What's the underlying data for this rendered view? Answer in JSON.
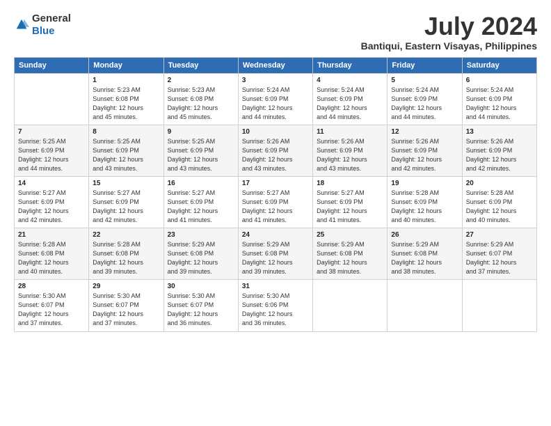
{
  "logo": {
    "general": "General",
    "blue": "Blue"
  },
  "header": {
    "title": "July 2024",
    "subtitle": "Bantiqui, Eastern Visayas, Philippines"
  },
  "weekdays": [
    "Sunday",
    "Monday",
    "Tuesday",
    "Wednesday",
    "Thursday",
    "Friday",
    "Saturday"
  ],
  "weeks": [
    [
      {
        "day": "",
        "info": ""
      },
      {
        "day": "1",
        "info": "Sunrise: 5:23 AM\nSunset: 6:08 PM\nDaylight: 12 hours\nand 45 minutes."
      },
      {
        "day": "2",
        "info": "Sunrise: 5:23 AM\nSunset: 6:08 PM\nDaylight: 12 hours\nand 45 minutes."
      },
      {
        "day": "3",
        "info": "Sunrise: 5:24 AM\nSunset: 6:09 PM\nDaylight: 12 hours\nand 44 minutes."
      },
      {
        "day": "4",
        "info": "Sunrise: 5:24 AM\nSunset: 6:09 PM\nDaylight: 12 hours\nand 44 minutes."
      },
      {
        "day": "5",
        "info": "Sunrise: 5:24 AM\nSunset: 6:09 PM\nDaylight: 12 hours\nand 44 minutes."
      },
      {
        "day": "6",
        "info": "Sunrise: 5:24 AM\nSunset: 6:09 PM\nDaylight: 12 hours\nand 44 minutes."
      }
    ],
    [
      {
        "day": "7",
        "info": "Sunrise: 5:25 AM\nSunset: 6:09 PM\nDaylight: 12 hours\nand 44 minutes."
      },
      {
        "day": "8",
        "info": "Sunrise: 5:25 AM\nSunset: 6:09 PM\nDaylight: 12 hours\nand 43 minutes."
      },
      {
        "day": "9",
        "info": "Sunrise: 5:25 AM\nSunset: 6:09 PM\nDaylight: 12 hours\nand 43 minutes."
      },
      {
        "day": "10",
        "info": "Sunrise: 5:26 AM\nSunset: 6:09 PM\nDaylight: 12 hours\nand 43 minutes."
      },
      {
        "day": "11",
        "info": "Sunrise: 5:26 AM\nSunset: 6:09 PM\nDaylight: 12 hours\nand 43 minutes."
      },
      {
        "day": "12",
        "info": "Sunrise: 5:26 AM\nSunset: 6:09 PM\nDaylight: 12 hours\nand 42 minutes."
      },
      {
        "day": "13",
        "info": "Sunrise: 5:26 AM\nSunset: 6:09 PM\nDaylight: 12 hours\nand 42 minutes."
      }
    ],
    [
      {
        "day": "14",
        "info": "Sunrise: 5:27 AM\nSunset: 6:09 PM\nDaylight: 12 hours\nand 42 minutes."
      },
      {
        "day": "15",
        "info": "Sunrise: 5:27 AM\nSunset: 6:09 PM\nDaylight: 12 hours\nand 42 minutes."
      },
      {
        "day": "16",
        "info": "Sunrise: 5:27 AM\nSunset: 6:09 PM\nDaylight: 12 hours\nand 41 minutes."
      },
      {
        "day": "17",
        "info": "Sunrise: 5:27 AM\nSunset: 6:09 PM\nDaylight: 12 hours\nand 41 minutes."
      },
      {
        "day": "18",
        "info": "Sunrise: 5:27 AM\nSunset: 6:09 PM\nDaylight: 12 hours\nand 41 minutes."
      },
      {
        "day": "19",
        "info": "Sunrise: 5:28 AM\nSunset: 6:09 PM\nDaylight: 12 hours\nand 40 minutes."
      },
      {
        "day": "20",
        "info": "Sunrise: 5:28 AM\nSunset: 6:09 PM\nDaylight: 12 hours\nand 40 minutes."
      }
    ],
    [
      {
        "day": "21",
        "info": "Sunrise: 5:28 AM\nSunset: 6:08 PM\nDaylight: 12 hours\nand 40 minutes."
      },
      {
        "day": "22",
        "info": "Sunrise: 5:28 AM\nSunset: 6:08 PM\nDaylight: 12 hours\nand 39 minutes."
      },
      {
        "day": "23",
        "info": "Sunrise: 5:29 AM\nSunset: 6:08 PM\nDaylight: 12 hours\nand 39 minutes."
      },
      {
        "day": "24",
        "info": "Sunrise: 5:29 AM\nSunset: 6:08 PM\nDaylight: 12 hours\nand 39 minutes."
      },
      {
        "day": "25",
        "info": "Sunrise: 5:29 AM\nSunset: 6:08 PM\nDaylight: 12 hours\nand 38 minutes."
      },
      {
        "day": "26",
        "info": "Sunrise: 5:29 AM\nSunset: 6:08 PM\nDaylight: 12 hours\nand 38 minutes."
      },
      {
        "day": "27",
        "info": "Sunrise: 5:29 AM\nSunset: 6:07 PM\nDaylight: 12 hours\nand 37 minutes."
      }
    ],
    [
      {
        "day": "28",
        "info": "Sunrise: 5:30 AM\nSunset: 6:07 PM\nDaylight: 12 hours\nand 37 minutes."
      },
      {
        "day": "29",
        "info": "Sunrise: 5:30 AM\nSunset: 6:07 PM\nDaylight: 12 hours\nand 37 minutes."
      },
      {
        "day": "30",
        "info": "Sunrise: 5:30 AM\nSunset: 6:07 PM\nDaylight: 12 hours\nand 36 minutes."
      },
      {
        "day": "31",
        "info": "Sunrise: 5:30 AM\nSunset: 6:06 PM\nDaylight: 12 hours\nand 36 minutes."
      },
      {
        "day": "",
        "info": ""
      },
      {
        "day": "",
        "info": ""
      },
      {
        "day": "",
        "info": ""
      }
    ]
  ]
}
